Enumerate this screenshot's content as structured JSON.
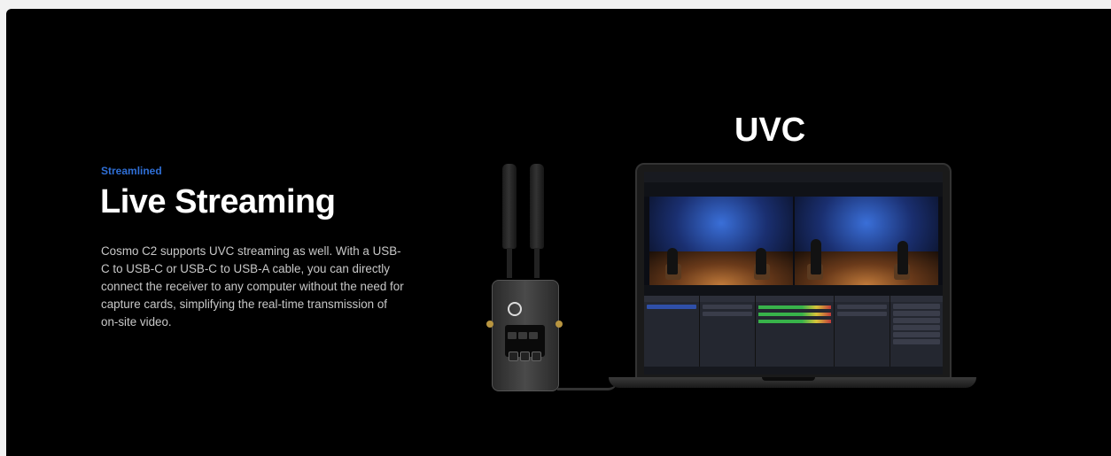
{
  "section": {
    "eyebrow": "Streamlined",
    "headline": "Live Streaming",
    "description": "Cosmo C2 supports UVC streaming as well. With a USB-C to USB-C or USB-C to USB-A cable, you can directly connect the receiver to any computer without the need for capture cards, simplifying the real-time transmission of on-site video."
  },
  "illustration": {
    "label": "UVC"
  },
  "colors": {
    "background": "#000000",
    "accent": "#2f6fd6",
    "text": "#ffffff",
    "body_text": "#c8c8c8"
  }
}
